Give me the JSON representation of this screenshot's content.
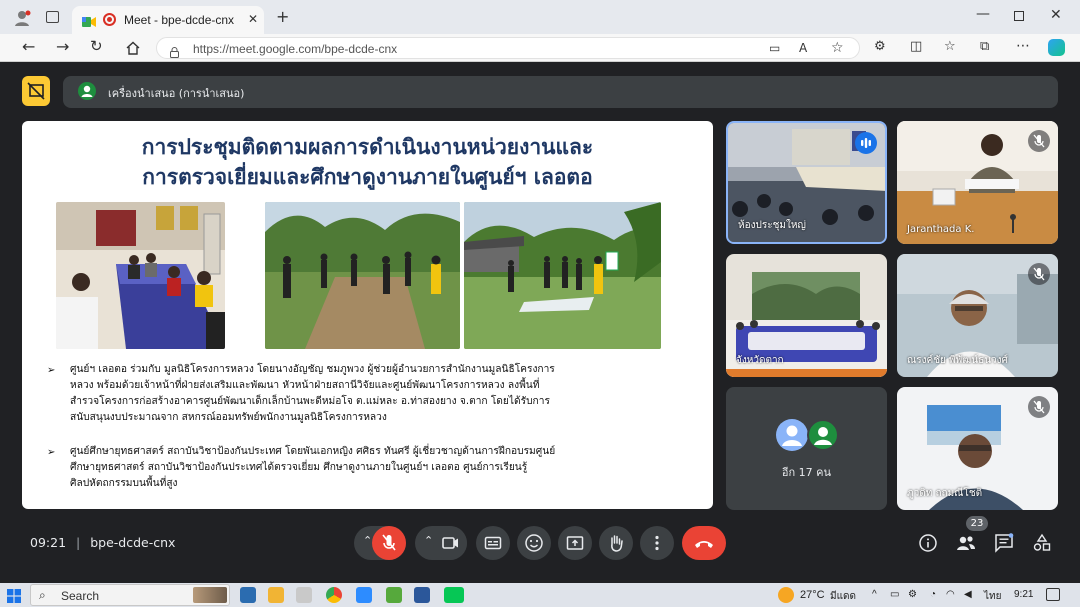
{
  "browser": {
    "tab_title": "Meet - bpe-dcde-cnx",
    "url": "https://meet.google.com/bpe-dcde-cnx"
  },
  "meet": {
    "presenter_label": "เครื่องนำเสนอ (การนำเสนอ)",
    "meeting_code": "bpe-dcde-cnx",
    "time": "09:21",
    "participant_count": "23",
    "others_label": "อีก 17 คน"
  },
  "slide": {
    "title_line1": "การประชุมติดตามผลการดำเนินงานหน่วยงานและ",
    "title_line2": "การตรวจเยี่ยมและศึกษาดูงานภายในศูนย์ฯ เลอตอ",
    "bullet_symbol": "➢",
    "bullets": [
      [
        "ศูนย์ฯ เลอตอ ร่วมกับ มูลนิธิโครงการหลวง โดยนางอัญชัญ ชมภูพวง ผู้ช่วยผู้อำนวยการสำนักงานมูลนิธิโครงการ",
        "หลวง พร้อมด้วยเจ้าหน้าที่ฝ่ายส่งเสริมและพัฒนา หัวหน้าฝ่ายสถานีวิจัยและศูนย์พัฒนาโครงการหลวง ลงพื้นที่",
        "สำรวจโครงการก่อสร้างอาคารศูนย์พัฒนาเด็กเล็กบ้านพะดีหม่อโจ ต.แม่หละ อ.ท่าสองยาง จ.ตาก โดยได้รับการ",
        "สนับสนุนงบประมาณจาก สหกรณ์ออมทรัพย์พนักงานมูลนิธิโครงการหลวง"
      ],
      [
        "ศูนย์ศึกษายุทธศาสตร์ สถาบันวิชาป้องกันประเทศ โดยพันเอกหญิง ศศิธร ทันศรี ผู้เชี่ยวชาญด้านการฝึกอบรมศูนย์",
        "ศึกษายุทธศาสตร์ สถาบันวิชาป้องกันประเทศได้ตรวจเยี่ยม ศึกษาดูงานภายในศูนย์ฯ เลอตอ ศูนย์การเรียนรู้",
        "ศิลปหัตถกรรมบนพื้นที่สูง"
      ]
    ]
  },
  "participants": [
    {
      "name": "ห้องประชุมใหญ่"
    },
    {
      "name": "Jaranthada K."
    },
    {
      "name": "จังหวัดตาก"
    },
    {
      "name": "ณรงค์ชัย พิพัฒน์ธนวงศ์"
    },
    {
      "name": "ภูวดิท ถถมณีโชติ"
    }
  ],
  "taskbar": {
    "search_label": "Search",
    "weather": "27°C",
    "weather_desc": "มีแดด",
    "lang": "ไทย",
    "clock": "9:21"
  },
  "colors": {
    "accent_blue": "#8ab4f8",
    "end_call_red": "#ea4335",
    "present_yellow": "#fcc934"
  }
}
